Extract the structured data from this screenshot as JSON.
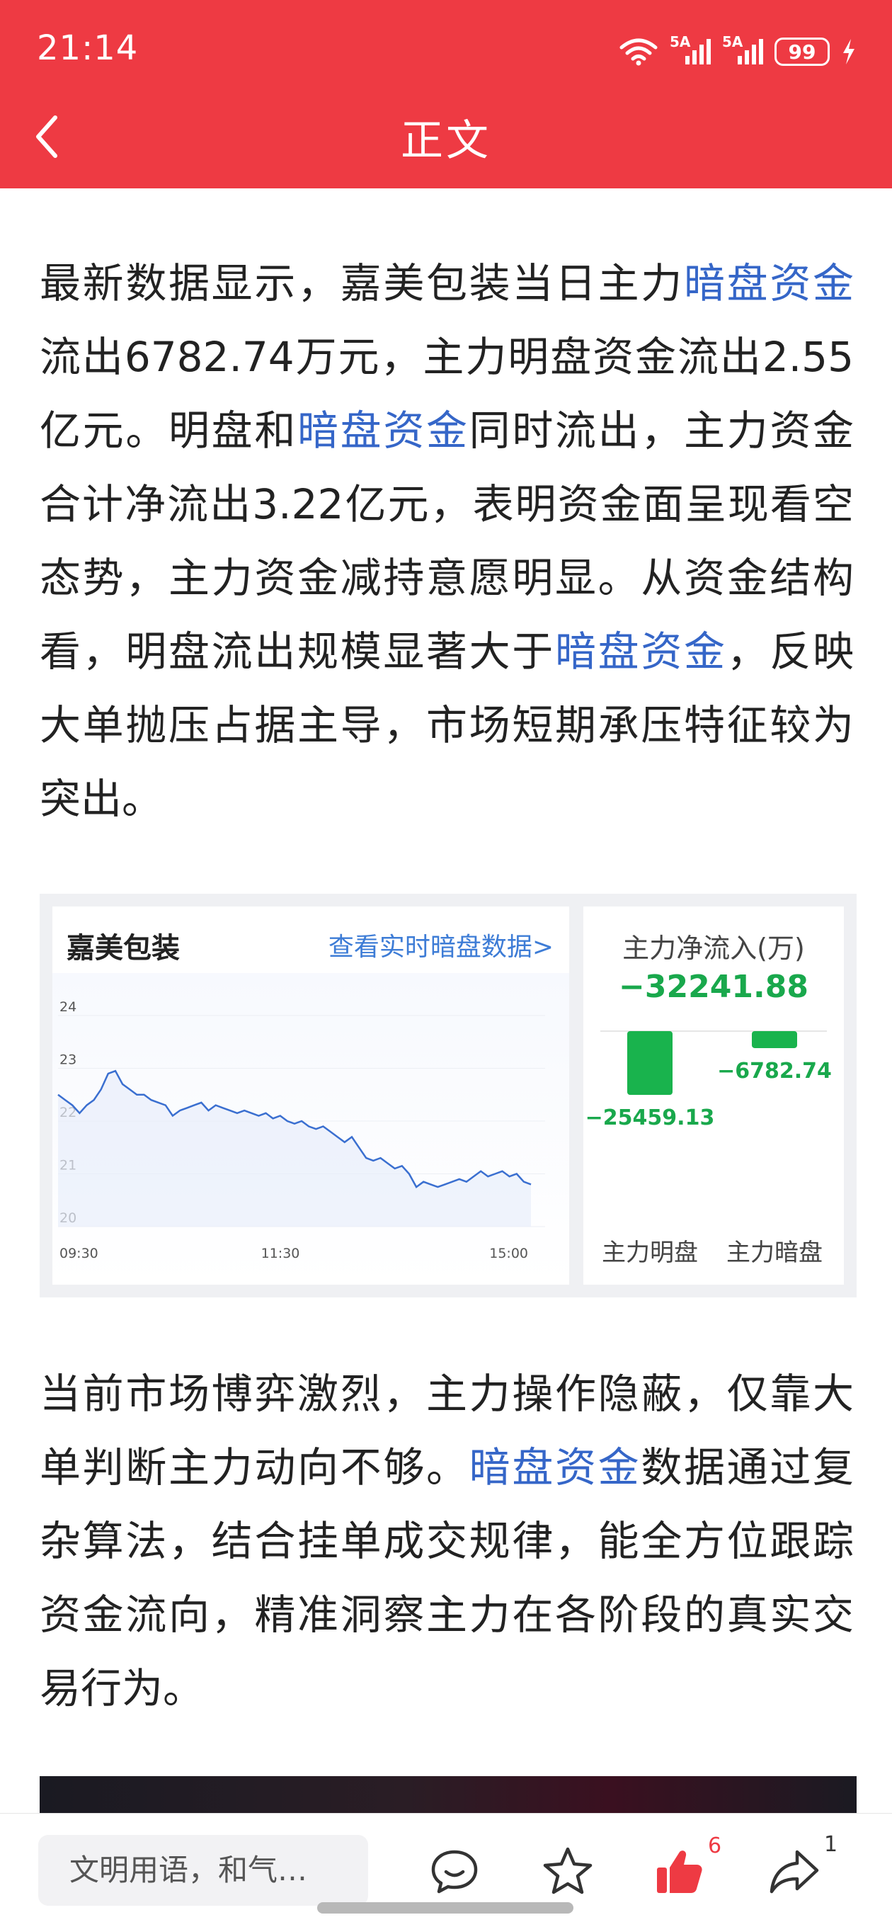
{
  "status_bar": {
    "time": "21:14",
    "sim1_label": "5A",
    "sim2_label": "5A",
    "battery": "99"
  },
  "header": {
    "title": "正文"
  },
  "article": {
    "p1": [
      {
        "t": "最新数据显示，嘉美包装当日主力"
      },
      {
        "t": "暗盘资金",
        "link": true
      },
      {
        "t": "流出6782.74万元，主力明盘资金流出2.55亿元。明盘和"
      },
      {
        "t": "暗盘资金",
        "link": true
      },
      {
        "t": "同时流出，主力资金合计净流出3.22亿元，表明资金面呈现看空态势，主力资金减持意愿明显。从资金结构看，明盘流出规模显著大于"
      },
      {
        "t": "暗盘资金",
        "link": true
      },
      {
        "t": "，反映大单抛压占据主导，市场短期承压特征较为突出。"
      }
    ],
    "p2": [
      {
        "t": "当前市场博弈激烈，主力操作隐蔽，仅靠大单判断主力动向不够。"
      },
      {
        "t": "暗盘资金",
        "link": true
      },
      {
        "t": "数据通过复杂算法，结合挂单成交规律，能全方位跟踪资金流向，精准洞察主力在各阶段的真实交易行为。"
      }
    ]
  },
  "widget": {
    "stock_name": "嘉美包装",
    "realtime_link": "查看实时暗盘数据>",
    "flow_label": "主力净流入(万)",
    "flow_value": "−32241.88"
  },
  "chart_data": [
    {
      "type": "line",
      "y_ticks": [
        "24",
        "23",
        "22",
        "21",
        "20"
      ],
      "ylim": [
        20,
        24
      ],
      "x_ticks": [
        "09:30",
        "11:30",
        "15:00"
      ],
      "series": [
        {
          "color": "#3a6fd0",
          "values": [
            22.5,
            22.4,
            22.3,
            22.15,
            22.3,
            22.4,
            22.6,
            22.9,
            22.95,
            22.7,
            22.6,
            22.5,
            22.5,
            22.4,
            22.35,
            22.3,
            22.1,
            22.2,
            22.25,
            22.3,
            22.35,
            22.2,
            22.3,
            22.25,
            22.2,
            22.15,
            22.2,
            22.15,
            22.1,
            22.15,
            22.05,
            22.1,
            22.0,
            21.95,
            22.0,
            21.9,
            21.85,
            21.9,
            21.8,
            21.7,
            21.6,
            21.7,
            21.5,
            21.3,
            21.25,
            21.3,
            21.2,
            21.1,
            21.15,
            21.0,
            20.75,
            20.85,
            20.8,
            20.75,
            20.8,
            20.85,
            20.9,
            20.85,
            20.95,
            21.05,
            20.95,
            21.0,
            21.05,
            20.95,
            21.0,
            20.85,
            20.8
          ]
        }
      ]
    },
    {
      "type": "bar",
      "categories": [
        "主力明盘",
        "主力暗盘"
      ],
      "values": [
        -25459.13,
        -6782.74
      ],
      "value_labels": [
        "−25459.13",
        "−6782.74"
      ],
      "colors": [
        "#19b34d",
        "#19b34d"
      ]
    }
  ],
  "bottom_bar": {
    "comment_placeholder": "文明用语，和气…",
    "like_count": "6",
    "share_count": "1"
  },
  "colors": {
    "header": "#ee3a43",
    "link": "#3566c8",
    "negative": "#19a84c"
  }
}
